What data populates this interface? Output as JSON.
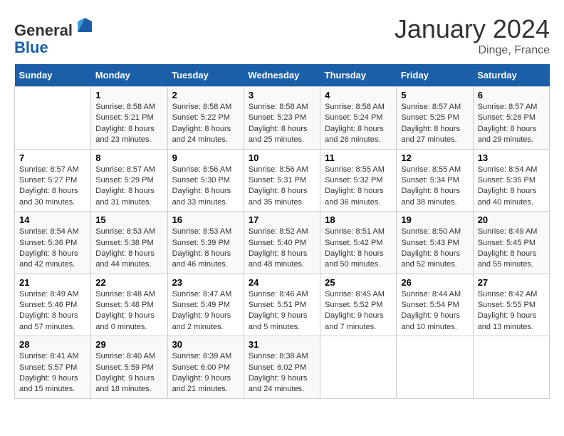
{
  "header": {
    "logo_line1": "General",
    "logo_line2": "Blue",
    "month": "January 2024",
    "location": "Dinge, France"
  },
  "days_of_week": [
    "Sunday",
    "Monday",
    "Tuesday",
    "Wednesday",
    "Thursday",
    "Friday",
    "Saturday"
  ],
  "weeks": [
    [
      {
        "day": "",
        "info": ""
      },
      {
        "day": "1",
        "info": "Sunrise: 8:58 AM\nSunset: 5:21 PM\nDaylight: 8 hours\nand 23 minutes."
      },
      {
        "day": "2",
        "info": "Sunrise: 8:58 AM\nSunset: 5:22 PM\nDaylight: 8 hours\nand 24 minutes."
      },
      {
        "day": "3",
        "info": "Sunrise: 8:58 AM\nSunset: 5:23 PM\nDaylight: 8 hours\nand 25 minutes."
      },
      {
        "day": "4",
        "info": "Sunrise: 8:58 AM\nSunset: 5:24 PM\nDaylight: 8 hours\nand 26 minutes."
      },
      {
        "day": "5",
        "info": "Sunrise: 8:57 AM\nSunset: 5:25 PM\nDaylight: 8 hours\nand 27 minutes."
      },
      {
        "day": "6",
        "info": "Sunrise: 8:57 AM\nSunset: 5:26 PM\nDaylight: 8 hours\nand 29 minutes."
      }
    ],
    [
      {
        "day": "7",
        "info": "Sunrise: 8:57 AM\nSunset: 5:27 PM\nDaylight: 8 hours\nand 30 minutes."
      },
      {
        "day": "8",
        "info": "Sunrise: 8:57 AM\nSunset: 5:29 PM\nDaylight: 8 hours\nand 31 minutes."
      },
      {
        "day": "9",
        "info": "Sunrise: 8:56 AM\nSunset: 5:30 PM\nDaylight: 8 hours\nand 33 minutes."
      },
      {
        "day": "10",
        "info": "Sunrise: 8:56 AM\nSunset: 5:31 PM\nDaylight: 8 hours\nand 35 minutes."
      },
      {
        "day": "11",
        "info": "Sunrise: 8:55 AM\nSunset: 5:32 PM\nDaylight: 8 hours\nand 36 minutes."
      },
      {
        "day": "12",
        "info": "Sunrise: 8:55 AM\nSunset: 5:34 PM\nDaylight: 8 hours\nand 38 minutes."
      },
      {
        "day": "13",
        "info": "Sunrise: 8:54 AM\nSunset: 5:35 PM\nDaylight: 8 hours\nand 40 minutes."
      }
    ],
    [
      {
        "day": "14",
        "info": "Sunrise: 8:54 AM\nSunset: 5:36 PM\nDaylight: 8 hours\nand 42 minutes."
      },
      {
        "day": "15",
        "info": "Sunrise: 8:53 AM\nSunset: 5:38 PM\nDaylight: 8 hours\nand 44 minutes."
      },
      {
        "day": "16",
        "info": "Sunrise: 8:53 AM\nSunset: 5:39 PM\nDaylight: 8 hours\nand 46 minutes."
      },
      {
        "day": "17",
        "info": "Sunrise: 8:52 AM\nSunset: 5:40 PM\nDaylight: 8 hours\nand 48 minutes."
      },
      {
        "day": "18",
        "info": "Sunrise: 8:51 AM\nSunset: 5:42 PM\nDaylight: 8 hours\nand 50 minutes."
      },
      {
        "day": "19",
        "info": "Sunrise: 8:50 AM\nSunset: 5:43 PM\nDaylight: 8 hours\nand 52 minutes."
      },
      {
        "day": "20",
        "info": "Sunrise: 8:49 AM\nSunset: 5:45 PM\nDaylight: 8 hours\nand 55 minutes."
      }
    ],
    [
      {
        "day": "21",
        "info": "Sunrise: 8:49 AM\nSunset: 5:46 PM\nDaylight: 8 hours\nand 57 minutes."
      },
      {
        "day": "22",
        "info": "Sunrise: 8:48 AM\nSunset: 5:48 PM\nDaylight: 9 hours\nand 0 minutes."
      },
      {
        "day": "23",
        "info": "Sunrise: 8:47 AM\nSunset: 5:49 PM\nDaylight: 9 hours\nand 2 minutes."
      },
      {
        "day": "24",
        "info": "Sunrise: 8:46 AM\nSunset: 5:51 PM\nDaylight: 9 hours\nand 5 minutes."
      },
      {
        "day": "25",
        "info": "Sunrise: 8:45 AM\nSunset: 5:52 PM\nDaylight: 9 hours\nand 7 minutes."
      },
      {
        "day": "26",
        "info": "Sunrise: 8:44 AM\nSunset: 5:54 PM\nDaylight: 9 hours\nand 10 minutes."
      },
      {
        "day": "27",
        "info": "Sunrise: 8:42 AM\nSunset: 5:55 PM\nDaylight: 9 hours\nand 13 minutes."
      }
    ],
    [
      {
        "day": "28",
        "info": "Sunrise: 8:41 AM\nSunset: 5:57 PM\nDaylight: 9 hours\nand 15 minutes."
      },
      {
        "day": "29",
        "info": "Sunrise: 8:40 AM\nSunset: 5:59 PM\nDaylight: 9 hours\nand 18 minutes."
      },
      {
        "day": "30",
        "info": "Sunrise: 8:39 AM\nSunset: 6:00 PM\nDaylight: 9 hours\nand 21 minutes."
      },
      {
        "day": "31",
        "info": "Sunrise: 8:38 AM\nSunset: 6:02 PM\nDaylight: 9 hours\nand 24 minutes."
      },
      {
        "day": "",
        "info": ""
      },
      {
        "day": "",
        "info": ""
      },
      {
        "day": "",
        "info": ""
      }
    ]
  ]
}
